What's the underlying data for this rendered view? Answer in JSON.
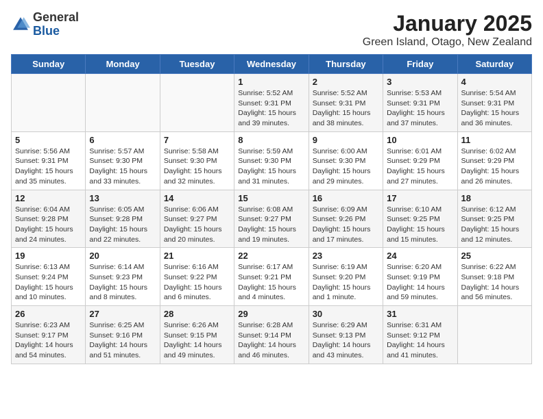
{
  "logo": {
    "general": "General",
    "blue": "Blue"
  },
  "title": "January 2025",
  "subtitle": "Green Island, Otago, New Zealand",
  "days_of_week": [
    "Sunday",
    "Monday",
    "Tuesday",
    "Wednesday",
    "Thursday",
    "Friday",
    "Saturday"
  ],
  "weeks": [
    [
      {
        "day": "",
        "detail": ""
      },
      {
        "day": "",
        "detail": ""
      },
      {
        "day": "",
        "detail": ""
      },
      {
        "day": "1",
        "detail": "Sunrise: 5:52 AM\nSunset: 9:31 PM\nDaylight: 15 hours\nand 39 minutes."
      },
      {
        "day": "2",
        "detail": "Sunrise: 5:52 AM\nSunset: 9:31 PM\nDaylight: 15 hours\nand 38 minutes."
      },
      {
        "day": "3",
        "detail": "Sunrise: 5:53 AM\nSunset: 9:31 PM\nDaylight: 15 hours\nand 37 minutes."
      },
      {
        "day": "4",
        "detail": "Sunrise: 5:54 AM\nSunset: 9:31 PM\nDaylight: 15 hours\nand 36 minutes."
      }
    ],
    [
      {
        "day": "5",
        "detail": "Sunrise: 5:56 AM\nSunset: 9:31 PM\nDaylight: 15 hours\nand 35 minutes."
      },
      {
        "day": "6",
        "detail": "Sunrise: 5:57 AM\nSunset: 9:30 PM\nDaylight: 15 hours\nand 33 minutes."
      },
      {
        "day": "7",
        "detail": "Sunrise: 5:58 AM\nSunset: 9:30 PM\nDaylight: 15 hours\nand 32 minutes."
      },
      {
        "day": "8",
        "detail": "Sunrise: 5:59 AM\nSunset: 9:30 PM\nDaylight: 15 hours\nand 31 minutes."
      },
      {
        "day": "9",
        "detail": "Sunrise: 6:00 AM\nSunset: 9:30 PM\nDaylight: 15 hours\nand 29 minutes."
      },
      {
        "day": "10",
        "detail": "Sunrise: 6:01 AM\nSunset: 9:29 PM\nDaylight: 15 hours\nand 27 minutes."
      },
      {
        "day": "11",
        "detail": "Sunrise: 6:02 AM\nSunset: 9:29 PM\nDaylight: 15 hours\nand 26 minutes."
      }
    ],
    [
      {
        "day": "12",
        "detail": "Sunrise: 6:04 AM\nSunset: 9:28 PM\nDaylight: 15 hours\nand 24 minutes."
      },
      {
        "day": "13",
        "detail": "Sunrise: 6:05 AM\nSunset: 9:28 PM\nDaylight: 15 hours\nand 22 minutes."
      },
      {
        "day": "14",
        "detail": "Sunrise: 6:06 AM\nSunset: 9:27 PM\nDaylight: 15 hours\nand 20 minutes."
      },
      {
        "day": "15",
        "detail": "Sunrise: 6:08 AM\nSunset: 9:27 PM\nDaylight: 15 hours\nand 19 minutes."
      },
      {
        "day": "16",
        "detail": "Sunrise: 6:09 AM\nSunset: 9:26 PM\nDaylight: 15 hours\nand 17 minutes."
      },
      {
        "day": "17",
        "detail": "Sunrise: 6:10 AM\nSunset: 9:25 PM\nDaylight: 15 hours\nand 15 minutes."
      },
      {
        "day": "18",
        "detail": "Sunrise: 6:12 AM\nSunset: 9:25 PM\nDaylight: 15 hours\nand 12 minutes."
      }
    ],
    [
      {
        "day": "19",
        "detail": "Sunrise: 6:13 AM\nSunset: 9:24 PM\nDaylight: 15 hours\nand 10 minutes."
      },
      {
        "day": "20",
        "detail": "Sunrise: 6:14 AM\nSunset: 9:23 PM\nDaylight: 15 hours\nand 8 minutes."
      },
      {
        "day": "21",
        "detail": "Sunrise: 6:16 AM\nSunset: 9:22 PM\nDaylight: 15 hours\nand 6 minutes."
      },
      {
        "day": "22",
        "detail": "Sunrise: 6:17 AM\nSunset: 9:21 PM\nDaylight: 15 hours\nand 4 minutes."
      },
      {
        "day": "23",
        "detail": "Sunrise: 6:19 AM\nSunset: 9:20 PM\nDaylight: 15 hours\nand 1 minute."
      },
      {
        "day": "24",
        "detail": "Sunrise: 6:20 AM\nSunset: 9:19 PM\nDaylight: 14 hours\nand 59 minutes."
      },
      {
        "day": "25",
        "detail": "Sunrise: 6:22 AM\nSunset: 9:18 PM\nDaylight: 14 hours\nand 56 minutes."
      }
    ],
    [
      {
        "day": "26",
        "detail": "Sunrise: 6:23 AM\nSunset: 9:17 PM\nDaylight: 14 hours\nand 54 minutes."
      },
      {
        "day": "27",
        "detail": "Sunrise: 6:25 AM\nSunset: 9:16 PM\nDaylight: 14 hours\nand 51 minutes."
      },
      {
        "day": "28",
        "detail": "Sunrise: 6:26 AM\nSunset: 9:15 PM\nDaylight: 14 hours\nand 49 minutes."
      },
      {
        "day": "29",
        "detail": "Sunrise: 6:28 AM\nSunset: 9:14 PM\nDaylight: 14 hours\nand 46 minutes."
      },
      {
        "day": "30",
        "detail": "Sunrise: 6:29 AM\nSunset: 9:13 PM\nDaylight: 14 hours\nand 43 minutes."
      },
      {
        "day": "31",
        "detail": "Sunrise: 6:31 AM\nSunset: 9:12 PM\nDaylight: 14 hours\nand 41 minutes."
      },
      {
        "day": "",
        "detail": ""
      }
    ]
  ]
}
